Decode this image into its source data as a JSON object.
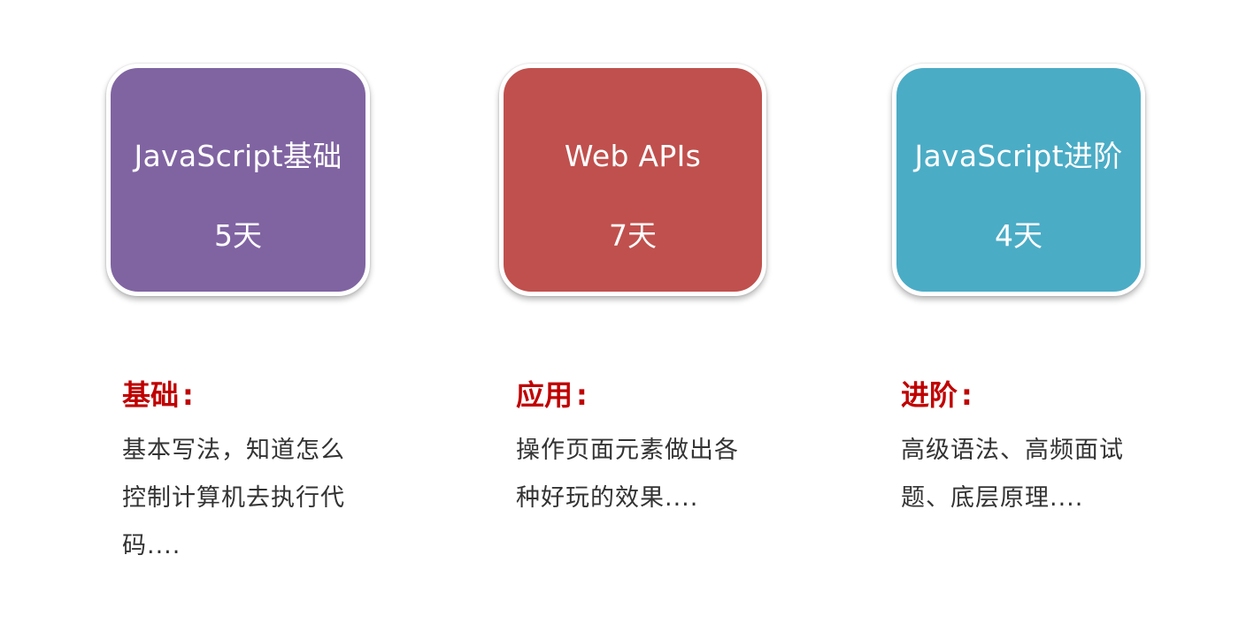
{
  "cards": [
    {
      "title": "JavaScript基础",
      "days": "5天",
      "color": "#8064a2"
    },
    {
      "title": "Web APIs",
      "days": "7天",
      "color": "#c0504d"
    },
    {
      "title": "JavaScript进阶",
      "days": "4天",
      "color": "#4bacc6"
    }
  ],
  "sections": [
    {
      "heading": "基础",
      "colon": ":",
      "body": "基本写法，知道怎么控制计算机去执行代码...."
    },
    {
      "heading": "应用",
      "colon": ":",
      "body": "操作页面元素做出各种好玩的效果...."
    },
    {
      "heading": "进阶",
      "colon": ":",
      "body": "高级语法、高频面试题、底层原理...."
    }
  ],
  "colors": {
    "heading": "#c00000",
    "body_text": "#333333"
  }
}
